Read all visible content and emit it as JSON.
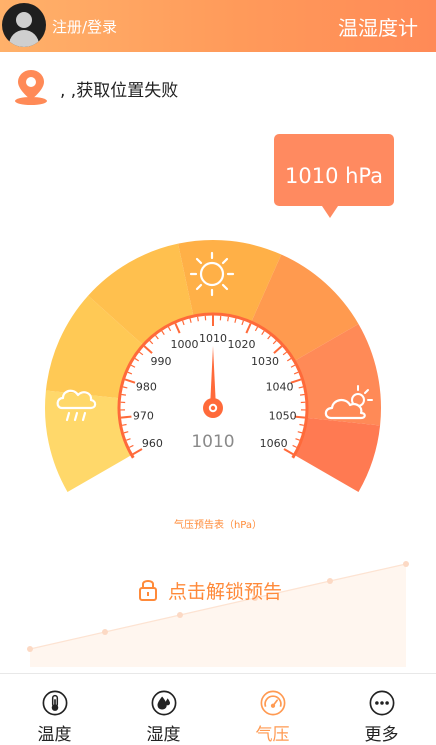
{
  "header": {
    "login_label": "注册/登录",
    "app_title": "温湿度计"
  },
  "location": {
    "status_text": ", ,获取位置失败",
    "icon": "location-pin-icon"
  },
  "reading": {
    "text": "1010 hPa",
    "value": 1010
  },
  "gauge": {
    "min": 960,
    "max": 1060,
    "step": 10,
    "value": 1010,
    "value_label": "1010",
    "tick_labels": [
      "960",
      "970",
      "980",
      "990",
      "1000",
      "1010",
      "1020",
      "1030",
      "1040",
      "1050",
      "1060"
    ],
    "caption": "气压预告表（hPa）",
    "icons": [
      "rain-cloud-icon",
      "sun-icon",
      "partly-cloudy-icon"
    ],
    "colors": {
      "yellow": "#ffd35a",
      "orange": "#ffb347",
      "coral": "#ff7f50",
      "needle": "#ff6a3a"
    }
  },
  "forecast": {
    "unlock_label": "点击解锁预告",
    "icon": "lock-icon"
  },
  "tabs": [
    {
      "label": "温度",
      "icon": "thermometer-icon",
      "active": false
    },
    {
      "label": "湿度",
      "icon": "humidity-drop-icon",
      "active": false
    },
    {
      "label": "气压",
      "icon": "pressure-gauge-icon",
      "active": true
    },
    {
      "label": "更多",
      "icon": "more-icon",
      "active": false
    }
  ],
  "accent_color": "#ff9a52"
}
